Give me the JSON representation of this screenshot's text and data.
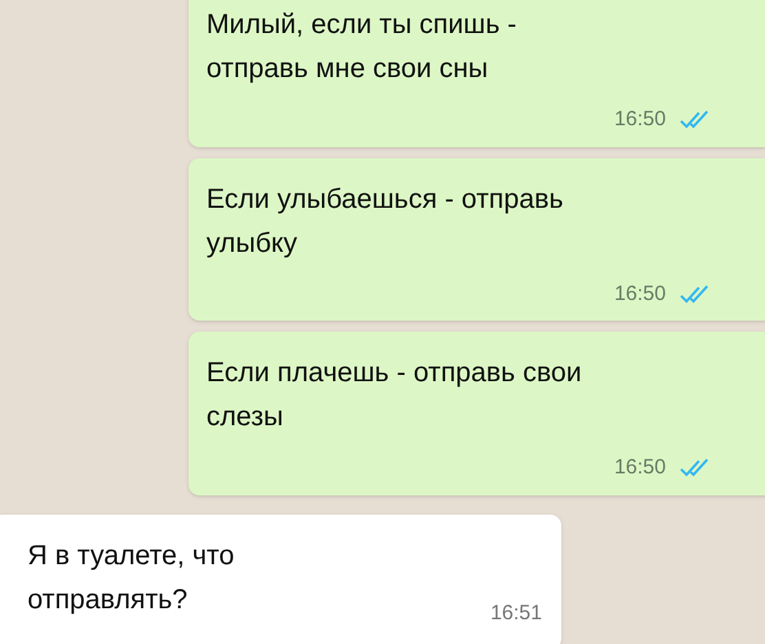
{
  "messages": [
    {
      "kind": "sent",
      "text": "Милый, если ты спишь - отправь мне свои сны",
      "time": "16:50",
      "read": true
    },
    {
      "kind": "sent",
      "text": "Если улыбаешься - отправь улыбку",
      "time": "16:50",
      "read": true
    },
    {
      "kind": "sent",
      "text": "Если плачешь - отправь свои слезы",
      "time": "16:50",
      "read": true
    },
    {
      "kind": "received",
      "text": "Я в туалете, что отправлять?",
      "time": "16:51"
    }
  ]
}
